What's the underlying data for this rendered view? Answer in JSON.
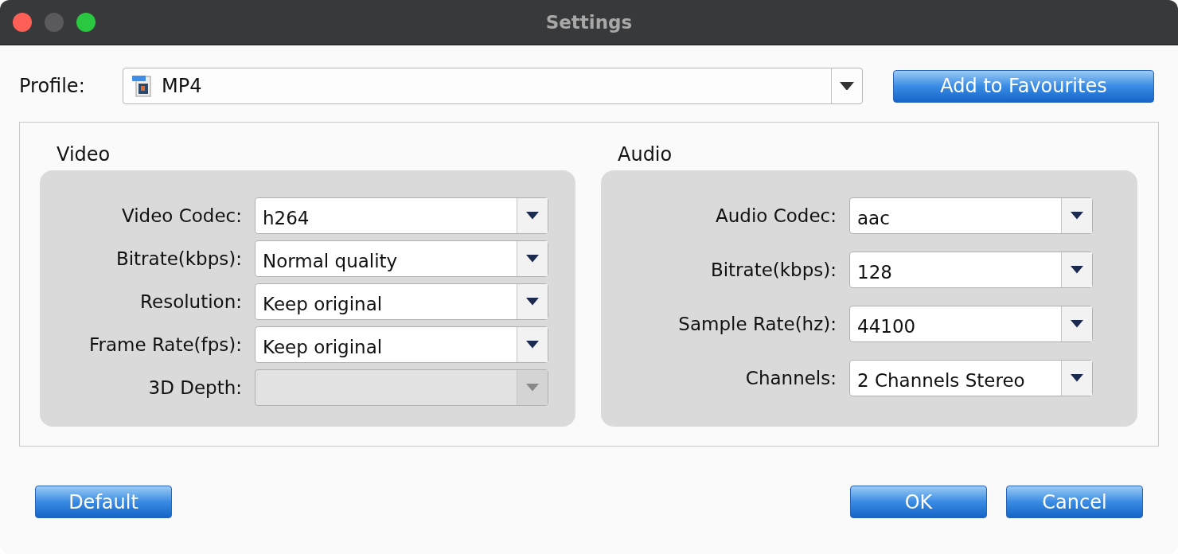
{
  "window": {
    "title": "Settings"
  },
  "profile": {
    "label": "Profile:",
    "value": "MP4",
    "button": "Add to Favourites"
  },
  "video": {
    "title": "Video",
    "fields": [
      {
        "label": "Video Codec:",
        "value": "h264",
        "disabled": false
      },
      {
        "label": "Bitrate(kbps):",
        "value": "Normal quality",
        "disabled": false
      },
      {
        "label": "Resolution:",
        "value": "Keep original",
        "disabled": false
      },
      {
        "label": "Frame Rate(fps):",
        "value": "Keep original",
        "disabled": false
      },
      {
        "label": "3D Depth:",
        "disabled": true
      }
    ]
  },
  "audio": {
    "title": "Audio",
    "fields": [
      {
        "label": "Audio Codec:",
        "value": "aac",
        "disabled": false
      },
      {
        "label": "Bitrate(kbps):",
        "value": "128",
        "disabled": false
      },
      {
        "label": "Sample Rate(hz):",
        "value": "44100",
        "disabled": false
      },
      {
        "label": "Channels:",
        "value": "2 Channels Stereo",
        "disabled": false
      }
    ]
  },
  "buttons": {
    "left": [
      "Default"
    ],
    "right": [
      "OK",
      "Cancel"
    ]
  }
}
